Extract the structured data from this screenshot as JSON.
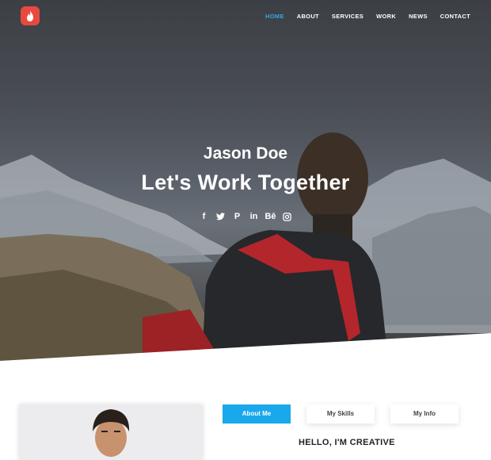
{
  "header": {
    "logo_icon": "flame-icon",
    "nav": [
      {
        "label": "HOME",
        "active": true
      },
      {
        "label": "ABOUT"
      },
      {
        "label": "SERVICES"
      },
      {
        "label": "WORK"
      },
      {
        "label": "NEWS"
      },
      {
        "label": "CONTACT"
      }
    ]
  },
  "hero": {
    "name": "Jason Doe",
    "tagline": "Let's Work Together",
    "social": [
      {
        "icon": "facebook-icon",
        "glyph": "f"
      },
      {
        "icon": "twitter-icon",
        "glyph": "🐦"
      },
      {
        "icon": "pinterest-icon",
        "glyph": "P"
      },
      {
        "icon": "linkedin-icon",
        "glyph": "in"
      },
      {
        "icon": "behance-icon",
        "glyph": "Bē"
      },
      {
        "icon": "instagram-icon",
        "glyph": "◎"
      }
    ]
  },
  "about": {
    "tabs": [
      {
        "label": "About Me",
        "active": true
      },
      {
        "label": "My Skills"
      },
      {
        "label": "My Info"
      }
    ],
    "heading": "HELLO, I'M CREATIVE"
  },
  "colors": {
    "accent": "#1aa8ec",
    "nav_active": "#2fa8e6",
    "logo": "#e8493f"
  }
}
